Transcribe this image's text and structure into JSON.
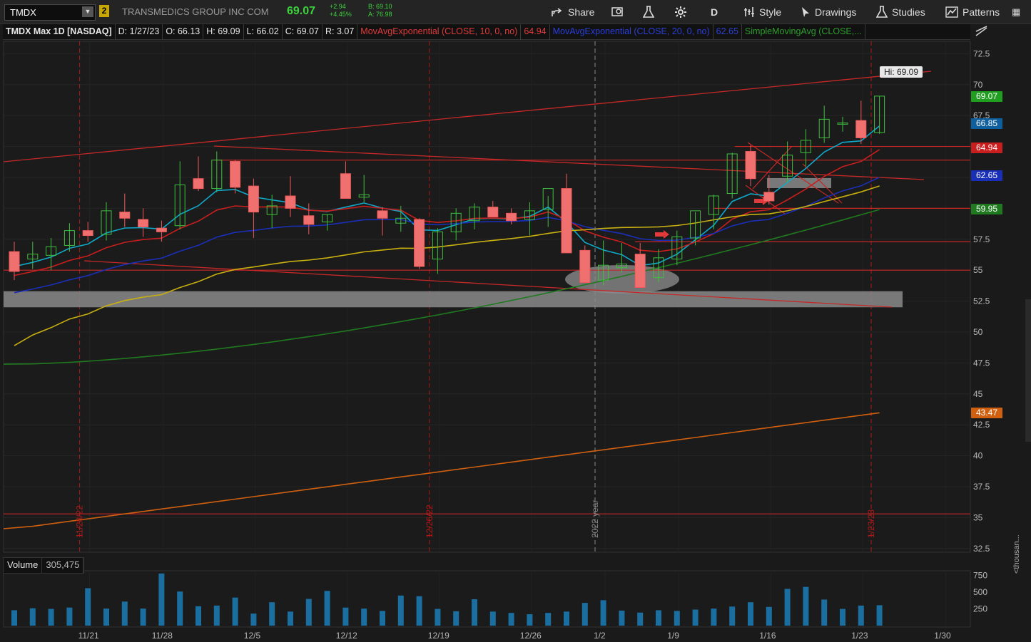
{
  "toolbar": {
    "symbol": "TMDX",
    "link_badge": "2",
    "company": "TRANSMEDICS GROUP INC COM",
    "last_price": "69.07",
    "net_change": "+2.94",
    "pct_change": "+4.45%",
    "bid": "B: 69.10",
    "ask": "A: 76.98",
    "share_label": "Share",
    "aggregation": "D",
    "style_label": "Style",
    "drawings_label": "Drawings",
    "studies_label": "Studies",
    "patterns_label": "Patterns"
  },
  "infobar": {
    "title": "TMDX Max 1D [NASDAQ]",
    "date": "D: 1/27/23",
    "open": "O: 66.13",
    "high": "H: 69.09",
    "low": "L: 66.02",
    "close": "C: 69.07",
    "range": "R: 3.07",
    "study1": "MovAvgExponential (CLOSE, 10, 0, no)",
    "study1_value": "64.94",
    "study2": "MovAvgExponential (CLOSE, 20, 0, no)",
    "study2_value": "62.65",
    "study3": "SimpleMovingAvg (CLOSE,..."
  },
  "hi_callout": "Hi: 69.09",
  "price_tags": [
    {
      "label": "69.07",
      "value": 69.07,
      "color": "#1f9e1f"
    },
    {
      "label": "66.85",
      "value": 66.85,
      "color": "#0f5f9f"
    },
    {
      "label": "64.94",
      "value": 64.94,
      "color": "#c81e1e"
    },
    {
      "label": "62.65",
      "value": 62.65,
      "color": "#1a2fb8"
    },
    {
      "label": "59.95",
      "value": 59.95,
      "color": "#1f7a1f"
    },
    {
      "label": "43.47",
      "value": 43.47,
      "color": "#d06010"
    }
  ],
  "volume": {
    "label": "Volume",
    "value": "305,475",
    "unit_label": "<thousan..."
  },
  "chart_data": {
    "type": "candlestick",
    "price_ticks": [
      72.5,
      70,
      67.5,
      65,
      62.5,
      60,
      57.5,
      55,
      52.5,
      50,
      47.5,
      45,
      42.5,
      40,
      37.5,
      35,
      32.5
    ],
    "price_tick_labels": [
      "72.5",
      "70",
      "67.5",
      "65",
      "62.5",
      "60",
      "57.5",
      "55",
      "52.5",
      "50",
      "47.5",
      "45",
      "42.5",
      "40",
      "37.5",
      "35",
      "32.5"
    ],
    "ylim": [
      32.2,
      73.5
    ],
    "volume_ticks": [
      750,
      500,
      250
    ],
    "volume_tick_labels": [
      "750",
      "500",
      "250"
    ],
    "x_labels": [
      "11/21",
      "11/28",
      "12/5",
      "12/12",
      "12/19",
      "12/26",
      "1/2",
      "1/9",
      "1/16",
      "1/23",
      "1/30"
    ],
    "period_labels": [
      {
        "text": "11/28/22",
        "idx": 2
      },
      {
        "text": "12/26/22",
        "idx": 21
      },
      {
        "text": "2022 year",
        "idx": 30
      },
      {
        "text": "1/23/23",
        "idx": 45
      }
    ],
    "candles": [
      {
        "o": 56.5,
        "h": 57.3,
        "l": 54.2,
        "c": 54.9,
        "v": 230
      },
      {
        "o": 55.9,
        "h": 57.3,
        "l": 55.1,
        "c": 56.3,
        "v": 260
      },
      {
        "o": 56.2,
        "h": 57.6,
        "l": 55.0,
        "c": 56.9,
        "v": 250
      },
      {
        "o": 57.0,
        "h": 58.8,
        "l": 56.5,
        "c": 58.2,
        "v": 270
      },
      {
        "o": 58.2,
        "h": 58.9,
        "l": 57.3,
        "c": 57.8,
        "v": 560
      },
      {
        "o": 57.9,
        "h": 60.5,
        "l": 57.4,
        "c": 59.8,
        "v": 255
      },
      {
        "o": 59.7,
        "h": 61.2,
        "l": 58.5,
        "c": 59.2,
        "v": 360
      },
      {
        "o": 59.1,
        "h": 60.0,
        "l": 57.7,
        "c": 58.5,
        "v": 255
      },
      {
        "o": 58.4,
        "h": 59.0,
        "l": 57.3,
        "c": 58.1,
        "v": 780
      },
      {
        "o": 58.6,
        "h": 63.8,
        "l": 58.3,
        "c": 61.9,
        "v": 510
      },
      {
        "o": 62.4,
        "h": 64.2,
        "l": 61.4,
        "c": 61.6,
        "v": 290
      },
      {
        "o": 61.6,
        "h": 64.6,
        "l": 61.3,
        "c": 63.9,
        "v": 300
      },
      {
        "o": 63.8,
        "h": 63.9,
        "l": 61.2,
        "c": 61.7,
        "v": 420
      },
      {
        "o": 61.8,
        "h": 62.4,
        "l": 57.6,
        "c": 59.7,
        "v": 180
      },
      {
        "o": 59.5,
        "h": 61.1,
        "l": 58.4,
        "c": 60.2,
        "v": 350
      },
      {
        "o": 61.0,
        "h": 62.6,
        "l": 59.3,
        "c": 60.0,
        "v": 210
      },
      {
        "o": 59.4,
        "h": 60.4,
        "l": 57.9,
        "c": 58.7,
        "v": 400
      },
      {
        "o": 58.9,
        "h": 59.5,
        "l": 58.2,
        "c": 59.5,
        "v": 520
      },
      {
        "o": 62.8,
        "h": 63.8,
        "l": 60.8,
        "c": 60.8,
        "v": 270
      },
      {
        "o": 60.9,
        "h": 62.7,
        "l": 60.5,
        "c": 61.1,
        "v": 255
      },
      {
        "o": 59.8,
        "h": 60.1,
        "l": 57.8,
        "c": 59.2,
        "v": 220
      },
      {
        "o": 58.8,
        "h": 60.2,
        "l": 58.1,
        "c": 59.2,
        "v": 450
      },
      {
        "o": 59.1,
        "h": 59.2,
        "l": 55.1,
        "c": 55.3,
        "v": 440
      },
      {
        "o": 55.9,
        "h": 58.4,
        "l": 54.7,
        "c": 58.1,
        "v": 250
      },
      {
        "o": 58.1,
        "h": 60.0,
        "l": 57.4,
        "c": 59.6,
        "v": 215
      },
      {
        "o": 59.0,
        "h": 60.4,
        "l": 58.3,
        "c": 60.1,
        "v": 395
      },
      {
        "o": 60.1,
        "h": 60.6,
        "l": 59.4,
        "c": 59.3,
        "v": 210
      },
      {
        "o": 59.6,
        "h": 60.0,
        "l": 58.7,
        "c": 59.0,
        "v": 190
      },
      {
        "o": 59.1,
        "h": 60.5,
        "l": 57.8,
        "c": 59.8,
        "v": 170
      },
      {
        "o": 59.9,
        "h": 61.0,
        "l": 58.5,
        "c": 61.6,
        "v": 190
      },
      {
        "o": 61.6,
        "h": 62.8,
        "l": 56.4,
        "c": 56.4,
        "v": 210
      },
      {
        "o": 56.6,
        "h": 57.0,
        "l": 54.4,
        "c": 54.0,
        "v": 340
      },
      {
        "o": 54.2,
        "h": 57.4,
        "l": 53.8,
        "c": 55.4,
        "v": 380
      },
      {
        "o": 55.2,
        "h": 57.2,
        "l": 54.8,
        "c": 55.5,
        "v": 225
      },
      {
        "o": 56.3,
        "h": 57.2,
        "l": 54.5,
        "c": 53.6,
        "v": 195
      },
      {
        "o": 54.4,
        "h": 56.7,
        "l": 54.0,
        "c": 56.0,
        "v": 230
      },
      {
        "o": 55.9,
        "h": 58.2,
        "l": 55.4,
        "c": 57.7,
        "v": 220
      },
      {
        "o": 57.6,
        "h": 59.7,
        "l": 57.0,
        "c": 59.8,
        "v": 240
      },
      {
        "o": 59.5,
        "h": 61.1,
        "l": 58.3,
        "c": 61.0,
        "v": 255
      },
      {
        "o": 61.2,
        "h": 64.5,
        "l": 60.8,
        "c": 64.4,
        "v": 285
      },
      {
        "o": 64.6,
        "h": 65.1,
        "l": 61.8,
        "c": 62.4,
        "v": 350
      },
      {
        "o": 61.3,
        "h": 62.7,
        "l": 60.3,
        "c": 60.6,
        "v": 280
      },
      {
        "o": 62.6,
        "h": 65.4,
        "l": 62.1,
        "c": 64.3,
        "v": 550
      },
      {
        "o": 64.5,
        "h": 66.4,
        "l": 63.4,
        "c": 65.5,
        "v": 580
      },
      {
        "o": 65.7,
        "h": 68.3,
        "l": 65.3,
        "c": 67.2,
        "v": 390
      },
      {
        "o": 66.8,
        "h": 67.4,
        "l": 66.2,
        "c": 66.9,
        "v": 250
      },
      {
        "o": 67.1,
        "h": 68.7,
        "l": 65.2,
        "c": 65.7,
        "v": 300
      },
      {
        "o": 66.13,
        "h": 69.09,
        "l": 66.02,
        "c": 69.07,
        "v": 305
      }
    ],
    "studies": [
      {
        "name": "MovAvgExponential (CLOSE, 10, 0, no)",
        "color": "#c81e1e",
        "last": 64.94
      },
      {
        "name": "MovAvgExponential (CLOSE, 20, 0, no)",
        "color": "#1a2fb8",
        "last": 62.65
      },
      {
        "name": "SimpleMovingAvg (CLOSE,...",
        "color": "#1f7a1f",
        "last": 59.95
      },
      {
        "name": "",
        "color": "#0fa9c9",
        "last": 66.85
      },
      {
        "name": "",
        "color": "#c8b010",
        "last": 61.0
      },
      {
        "name": "",
        "color": "#d06010",
        "last": 43.47
      }
    ],
    "horizontal_levels": [
      65.0,
      63.9,
      60.0,
      57.3,
      55.0,
      35.3
    ],
    "support_zone": [
      52.0,
      53.3
    ]
  }
}
